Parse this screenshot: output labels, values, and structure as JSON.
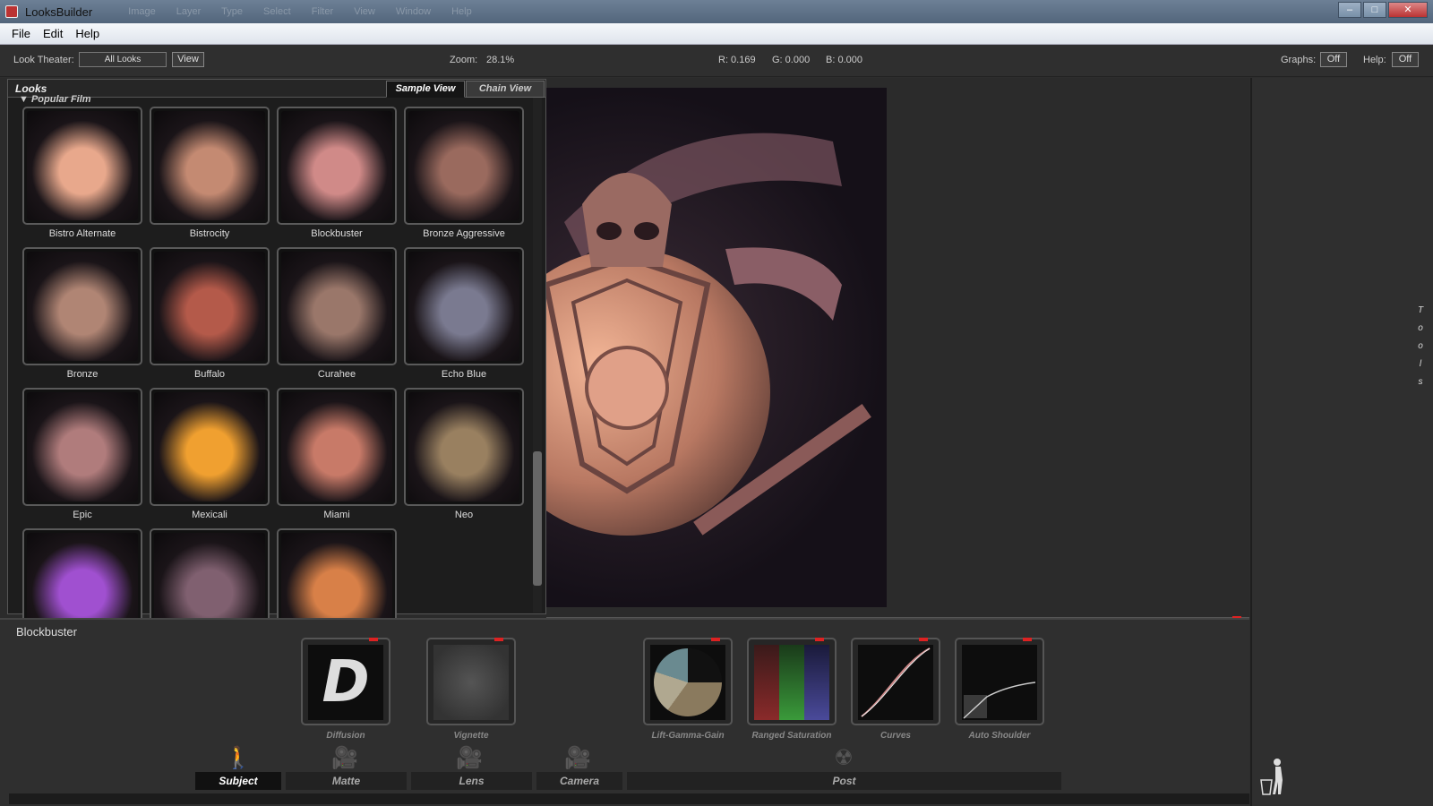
{
  "window": {
    "title": "LooksBuilder",
    "ghost_menu": "Image Layer Type Select Filter View Window Help"
  },
  "menubar": {
    "items": [
      "File",
      "Edit",
      "Help"
    ]
  },
  "toolbar": {
    "look_theater_label": "Look Theater:",
    "look_theater_value": "All Looks",
    "view_button": "View",
    "zoom_label": "Zoom:",
    "zoom_value": "28.1%",
    "r_readout": "R: 0.169",
    "g_readout": "G: 0.000",
    "b_readout": "B: 0.000",
    "graphs_label": "Graphs:",
    "graphs_value": "Off",
    "help_label": "Help:",
    "help_value": "Off"
  },
  "looks": {
    "title": "Looks",
    "tab_sample": "Sample View",
    "tab_chain": "Chain View",
    "category": "Popular Film",
    "items": [
      {
        "label": "Bistro Alternate",
        "color": "#e8a88c"
      },
      {
        "label": "Bistrocity",
        "color": "#c48a72"
      },
      {
        "label": "Blockbuster",
        "color": "#d08a88"
      },
      {
        "label": "Bronze Aggressive",
        "color": "#9a6a5e"
      },
      {
        "label": "Bronze",
        "color": "#b08574"
      },
      {
        "label": "Buffalo",
        "color": "#b45a4a"
      },
      {
        "label": "Curahee",
        "color": "#9a776a"
      },
      {
        "label": "Echo Blue",
        "color": "#7a7a90"
      },
      {
        "label": "Epic",
        "color": "#b07c7c"
      },
      {
        "label": "Mexicali",
        "color": "#f0a030"
      },
      {
        "label": "Miami",
        "color": "#c87a68"
      },
      {
        "label": "Neo",
        "color": "#998060"
      },
      {
        "label": "",
        "color": "#a050d0"
      },
      {
        "label": "",
        "color": "#806070"
      },
      {
        "label": "",
        "color": "#d88048"
      }
    ]
  },
  "tools_tab_text": "Tools",
  "chain": {
    "look_name": "Blockbuster",
    "tools": [
      {
        "label": "Diffusion",
        "icon": "diffusion-d-icon"
      },
      {
        "label": "Vignette",
        "icon": "vignette-icon"
      },
      {
        "label": "Lift-Gamma-Gain",
        "icon": "color-wheel-icon"
      },
      {
        "label": "Ranged Saturation",
        "icon": "rgb-bars-icon"
      },
      {
        "label": "Curves",
        "icon": "curve-icon"
      },
      {
        "label": "Auto Shoulder",
        "icon": "shoulder-curve-icon"
      }
    ],
    "categories": [
      "Subject",
      "Matte",
      "Lens",
      "Camera",
      "Post"
    ],
    "active_category": "Subject"
  }
}
